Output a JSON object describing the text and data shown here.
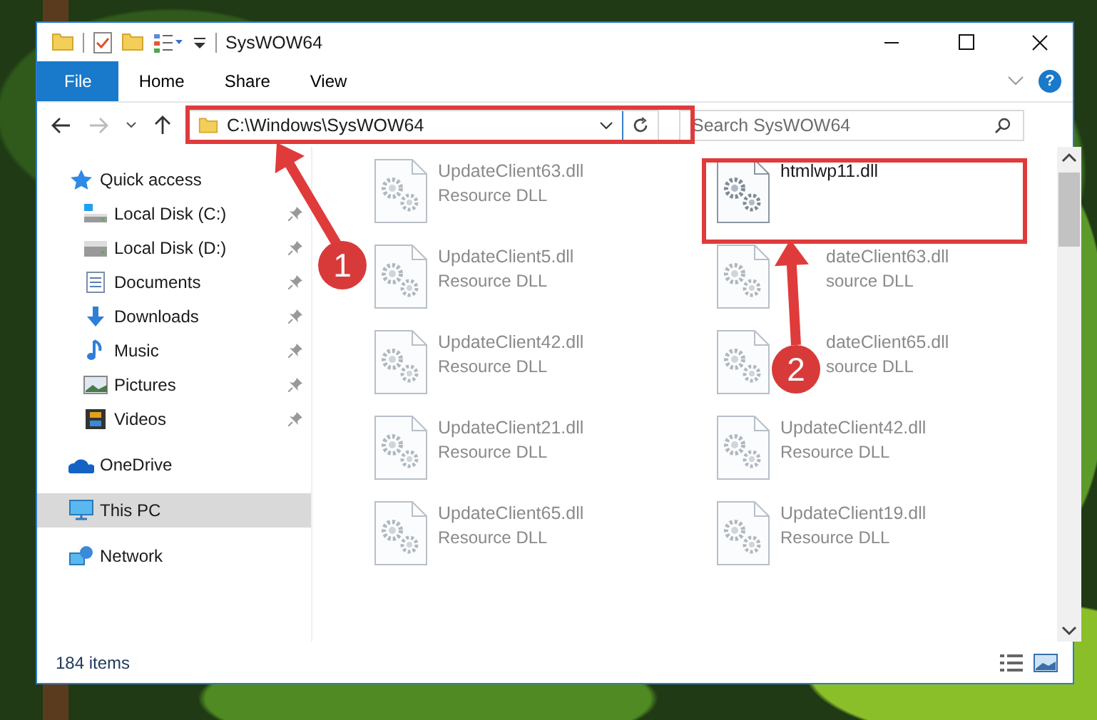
{
  "window": {
    "title": "SysWOW64"
  },
  "ribbon": {
    "tabs": [
      {
        "label": "File",
        "kind": "file"
      },
      {
        "label": "Home",
        "kind": "tab"
      },
      {
        "label": "Share",
        "kind": "tab"
      },
      {
        "label": "View",
        "kind": "tab"
      }
    ],
    "help": "?"
  },
  "address": {
    "path": "C:\\Windows\\SysWOW64"
  },
  "search": {
    "placeholder": "Search SysWOW64"
  },
  "nav": [
    {
      "label": "Quick access",
      "kind": "star",
      "selected": false,
      "children": [
        {
          "label": "Local Disk (C:)",
          "kind": "drive-win",
          "pinned": true,
          "selected": false
        },
        {
          "label": "Local Disk (D:)",
          "kind": "drive",
          "pinned": true,
          "selected": false
        },
        {
          "label": "Documents",
          "kind": "docs",
          "pinned": true,
          "selected": false
        },
        {
          "label": "Downloads",
          "kind": "downloads",
          "pinned": true,
          "selected": false
        },
        {
          "label": "Music",
          "kind": "music",
          "pinned": true,
          "selected": false
        },
        {
          "label": "Pictures",
          "kind": "pictures",
          "pinned": true,
          "selected": false
        },
        {
          "label": "Videos",
          "kind": "videos",
          "pinned": true,
          "selected": false
        }
      ]
    },
    {
      "label": "OneDrive",
      "kind": "cloud",
      "selected": false
    },
    {
      "label": "This PC",
      "kind": "pc",
      "selected": true
    },
    {
      "label": "Network",
      "kind": "network",
      "selected": false
    }
  ],
  "files": [
    {
      "name": "UpdateClient63.dll",
      "type": "Resource DLL",
      "blurred": true
    },
    {
      "name": "htmlwp11.dll",
      "blurred": false
    },
    {
      "name": "UpdateClient5.dll",
      "type": "Resource DLL",
      "blurred": true
    },
    {
      "name": "dateClient63.dll",
      "type": "source DLL",
      "blurred": true
    },
    {
      "name": "UpdateClient42.dll",
      "type": "Resource DLL",
      "blurred": true
    },
    {
      "name": "dateClient65.dll",
      "type": "source DLL",
      "blurred": true
    },
    {
      "name": "UpdateClient21.dll",
      "type": "Resource DLL",
      "blurred": true
    },
    {
      "name": "UpdateClient42.dll",
      "type": "Resource DLL",
      "blurred": true
    },
    {
      "name": "UpdateClient65.dll",
      "type": "Resource DLL",
      "blurred": true
    },
    {
      "name": "UpdateClient19.dll",
      "type": "Resource DLL",
      "blurred": true
    }
  ],
  "status_bar": {
    "count": "184 items"
  },
  "annotations": [
    {
      "label": "1"
    },
    {
      "label": "2"
    }
  ]
}
